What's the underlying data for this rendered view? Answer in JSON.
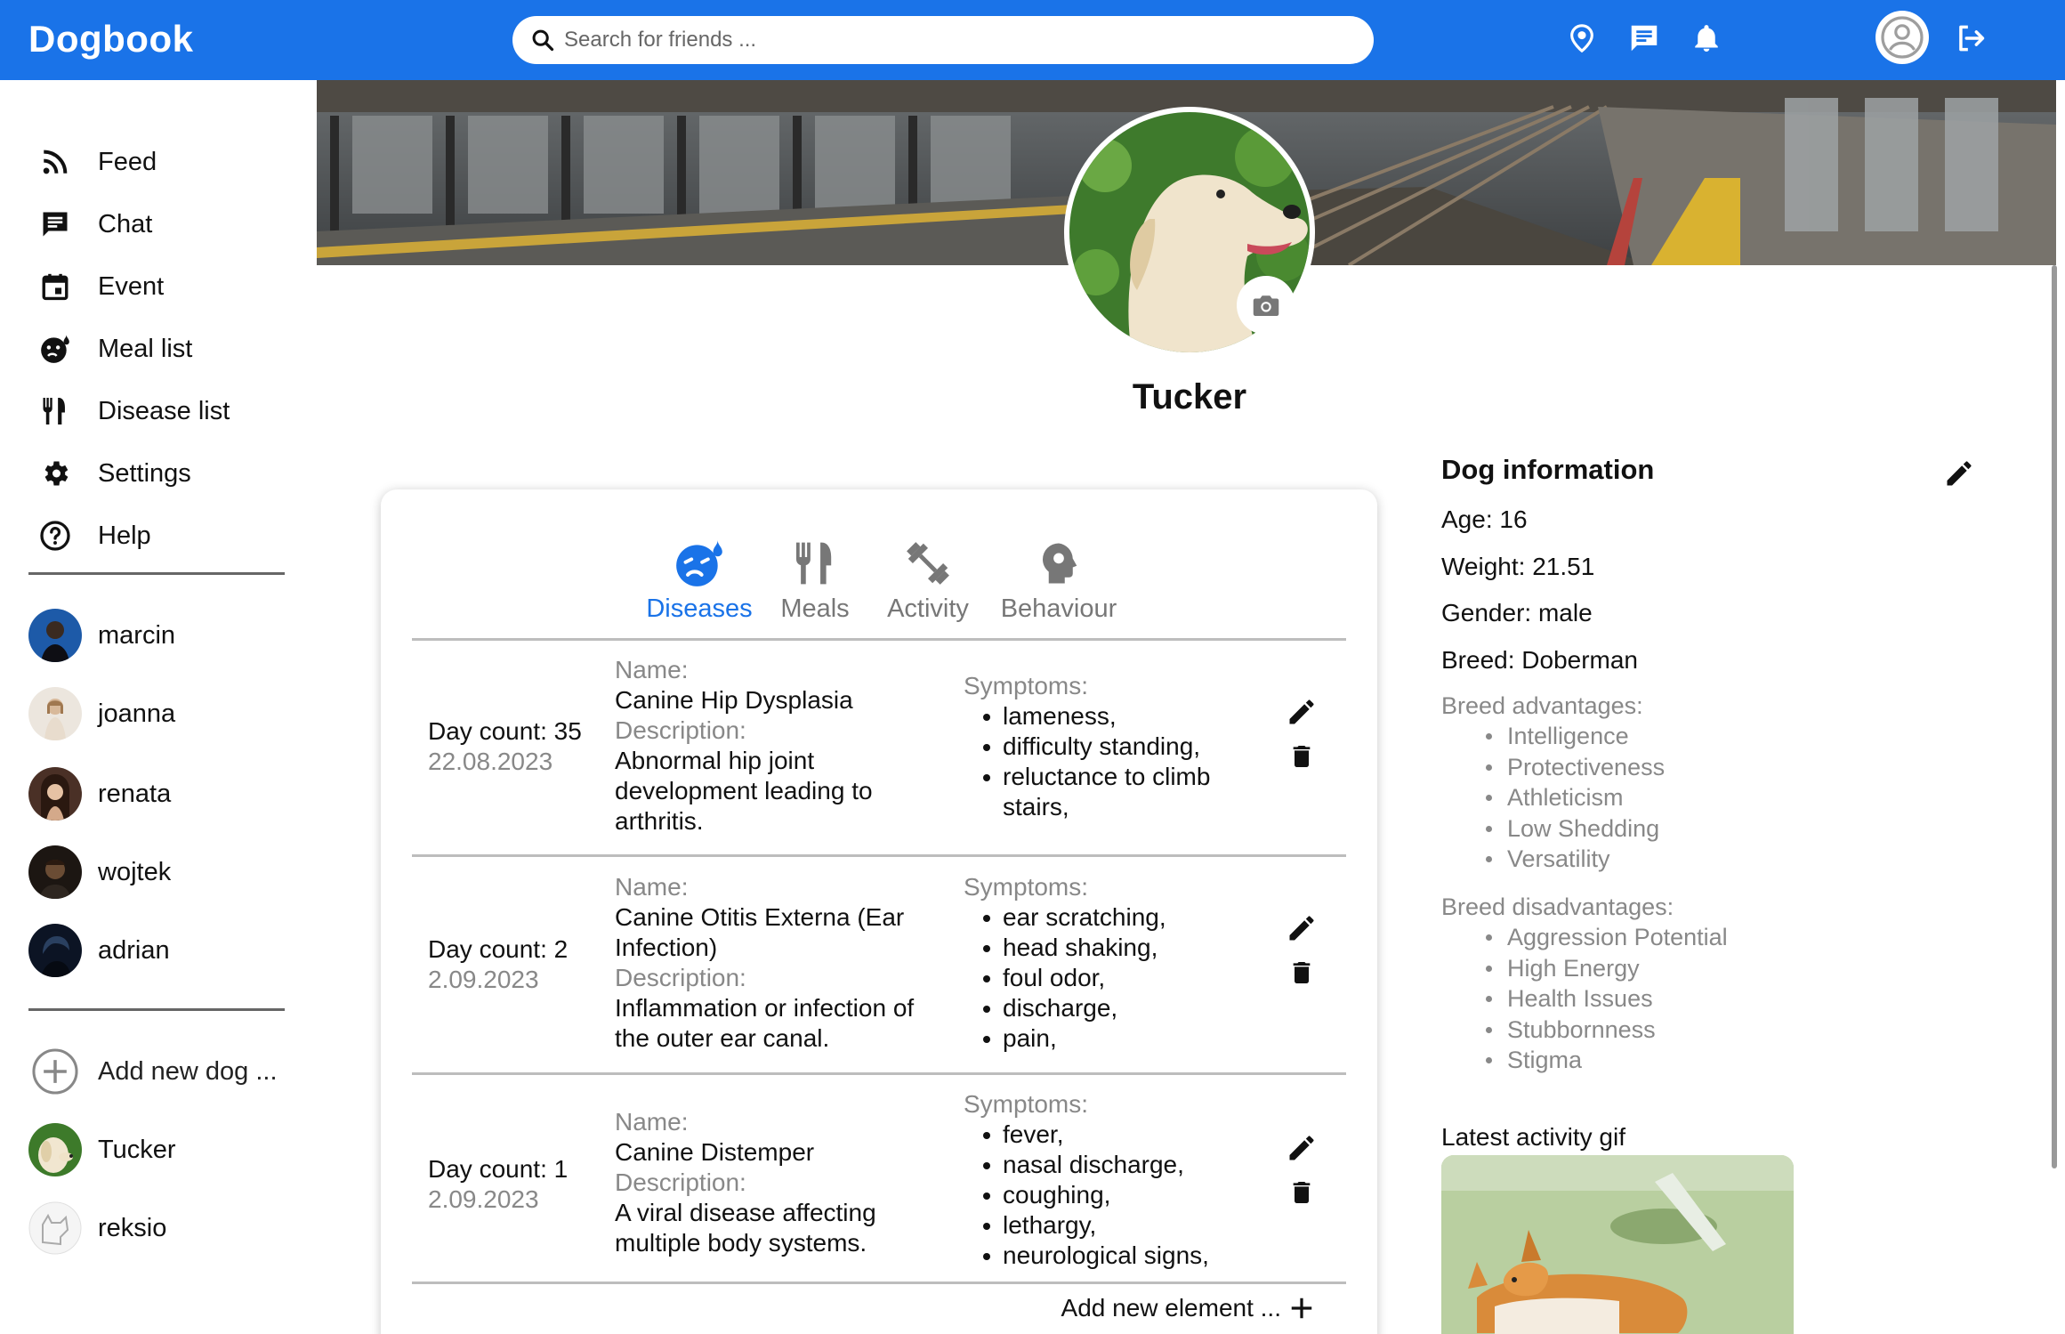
{
  "app": {
    "title": "Dogbook"
  },
  "search": {
    "placeholder": "Search for friends ..."
  },
  "topbar": {
    "icons": [
      "location-icon",
      "chat-icon",
      "bell-icon",
      "account-icon",
      "logout-icon"
    ],
    "brand_color": "#1a73e8"
  },
  "sidebar": {
    "nav": [
      {
        "label": "Feed",
        "icon": "rss-icon"
      },
      {
        "label": "Chat",
        "icon": "chat-icon"
      },
      {
        "label": "Event",
        "icon": "calendar-icon"
      },
      {
        "label": "Meal list",
        "icon": "virus-icon"
      },
      {
        "label": "Disease list",
        "icon": "cutlery-icon"
      },
      {
        "label": "Settings",
        "icon": "gear-icon"
      },
      {
        "label": "Help",
        "icon": "help-icon"
      }
    ],
    "friends": [
      {
        "name": "marcin"
      },
      {
        "name": "joanna"
      },
      {
        "name": "renata"
      },
      {
        "name": "wojtek"
      },
      {
        "name": "adrian"
      }
    ],
    "add_dog_label": "Add new dog ...",
    "dogs": [
      {
        "name": "Tucker"
      },
      {
        "name": "reksio"
      }
    ]
  },
  "profile": {
    "name": "Tucker"
  },
  "tabs": [
    {
      "label": "Diseases",
      "active": true,
      "icon": "virus-icon"
    },
    {
      "label": "Meals",
      "active": false,
      "icon": "cutlery-icon"
    },
    {
      "label": "Activity",
      "active": false,
      "icon": "dumbbell-icon"
    },
    {
      "label": "Behaviour",
      "active": false,
      "icon": "brain-head-icon"
    }
  ],
  "labels": {
    "name": "Name:",
    "description": "Description:",
    "symptoms": "Symptoms:"
  },
  "diseases": [
    {
      "day_count": "Day count: 35",
      "date": "22.08.2023",
      "name": "Canine Hip Dysplasia",
      "description": "Abnormal hip joint development leading to arthritis.",
      "symptoms": [
        "lameness,",
        "difficulty standing,",
        "reluctance to climb stairs,"
      ]
    },
    {
      "day_count": "Day count: 2",
      "date": "2.09.2023",
      "name": "Canine Otitis Externa (Ear Infection)",
      "description": "Inflammation or infection of the outer ear canal.",
      "symptoms": [
        "ear scratching,",
        "head shaking,",
        "foul odor,",
        "discharge,",
        "pain,"
      ]
    },
    {
      "day_count": "Day count: 1",
      "date": "2.09.2023",
      "name": "Canine Distemper",
      "description": "A viral disease affecting multiple body systems.",
      "symptoms": [
        "fever,",
        "nasal discharge,",
        "coughing,",
        "lethargy,",
        "neurological signs,"
      ]
    }
  ],
  "add_element_label": "Add new element ...",
  "dog_info": {
    "title": "Dog information",
    "age": "Age: 16",
    "weight": "Weight: 21.51",
    "gender": "Gender: male",
    "breed": "Breed: Doberman",
    "advantages_title": "Breed advantages:",
    "advantages": [
      "Intelligence",
      "Protectiveness",
      "Athleticism",
      "Low Shedding",
      "Versatility"
    ],
    "disadvantages_title": "Breed disadvantages:",
    "disadvantages": [
      "Aggression Potential",
      "High Energy",
      "Health Issues",
      "Stubbornness",
      "Stigma"
    ]
  },
  "gif": {
    "title": "Latest activity gif"
  }
}
